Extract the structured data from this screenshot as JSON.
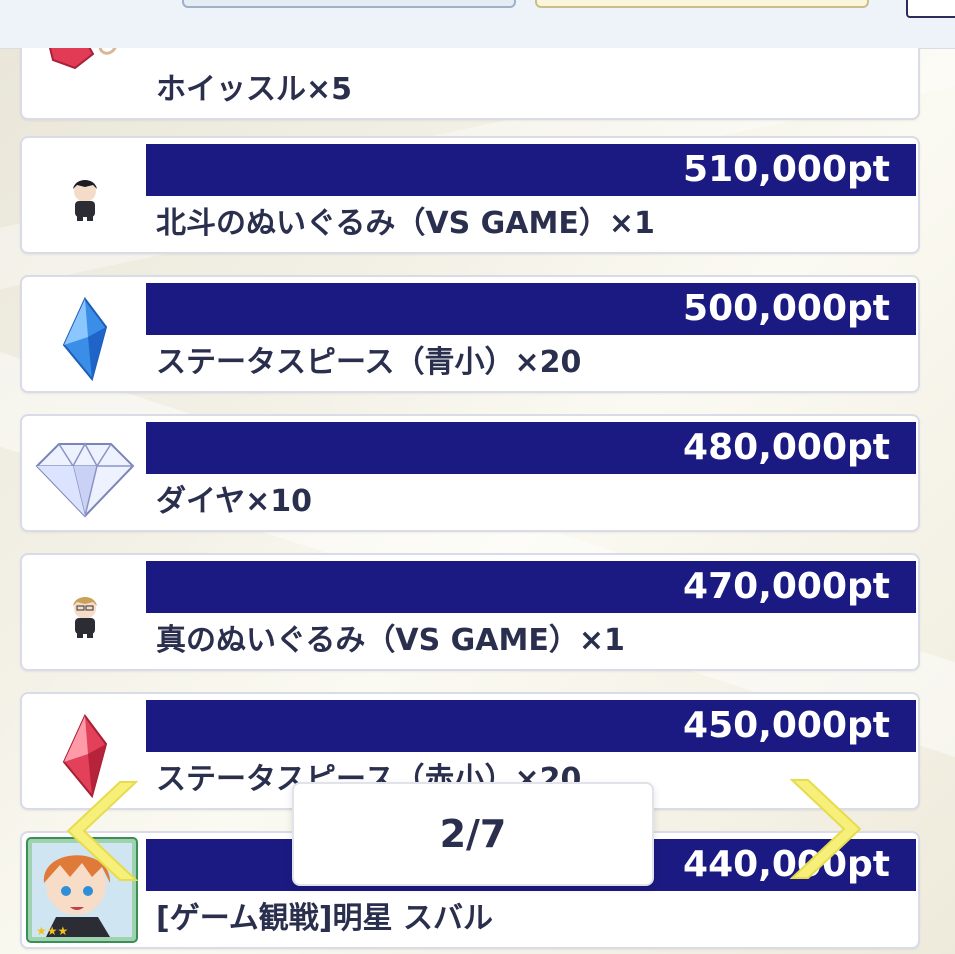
{
  "items": [
    {
      "points": "",
      "name": "ホイッスル×5",
      "icon": "whistle-icon"
    },
    {
      "points": "510,000pt",
      "name": "北斗のぬいぐるみ（VS GAME）×1",
      "icon": "plush-hokuto-icon"
    },
    {
      "points": "500,000pt",
      "name": "ステータスピース（青小）×20",
      "icon": "blue-crystal-icon"
    },
    {
      "points": "480,000pt",
      "name": "ダイヤ×10",
      "icon": "diamond-icon"
    },
    {
      "points": "470,000pt",
      "name": "真のぬいぐるみ（VS GAME）×1",
      "icon": "plush-makoto-icon"
    },
    {
      "points": "450,000pt",
      "name": "ステータスピース（赤小）×20",
      "icon": "red-crystal-icon"
    },
    {
      "points": "440,000pt",
      "name": "[ゲーム観戦]明星 スバル",
      "icon": "card-portrait-icon"
    }
  ],
  "pager": {
    "label": "2/7"
  },
  "colors": {
    "pt_bar": "#1b1a82",
    "text": "#2b2f4e",
    "arrow": "#f6f07a"
  }
}
